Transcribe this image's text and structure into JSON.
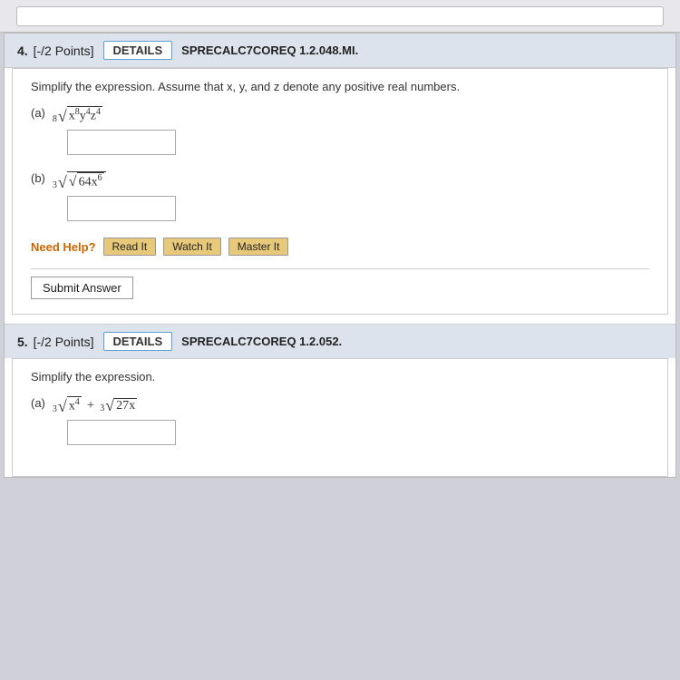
{
  "browser": {
    "address": ""
  },
  "problem4": {
    "header": {
      "number": "4.",
      "points": "[-/2 Points]",
      "details_label": "DETAILS",
      "code": "SPRECALC7COREQ 1.2.048.MI."
    },
    "instruction": "Simplify the expression. Assume that x, y, and z denote any positive real numbers.",
    "part_a": {
      "label": "(a)",
      "expr_description": "8th root of x^8 y^4 z^4"
    },
    "part_b": {
      "label": "(b)",
      "expr_description": "cube root of sqrt(64x^6)"
    },
    "need_help_label": "Need Help?",
    "read_it_label": "Read It",
    "watch_it_label": "Watch It",
    "master_it_label": "Master It",
    "submit_label": "Submit Answer"
  },
  "problem5": {
    "header": {
      "number": "5.",
      "points": "[-/2 Points]",
      "details_label": "DETAILS",
      "code": "SPRECALC7COREQ 1.2.052."
    },
    "instruction": "Simplify the expression.",
    "part_a": {
      "label": "(a)",
      "expr_description": "cube root of x^4 + cube root of 27x"
    }
  }
}
